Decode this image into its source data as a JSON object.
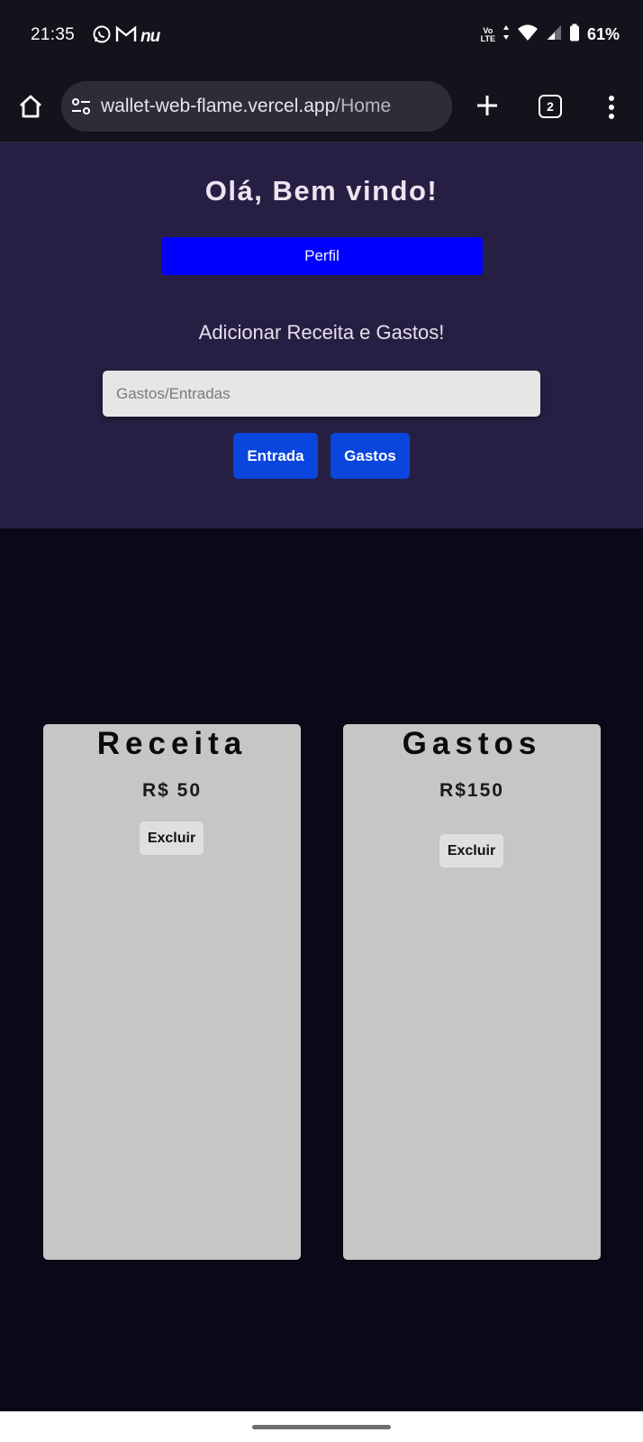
{
  "status_bar": {
    "time": "21:35",
    "notif_text": "nu",
    "battery": "61%",
    "volte_top": "Vo",
    "volte_bottom": "LTE"
  },
  "browser": {
    "url_host": "wallet-web-flame.vercel.app",
    "url_path": "/Home",
    "tab_count": "2"
  },
  "hero": {
    "title": "Olá, Bem vindo!",
    "profile_button": "Perfil",
    "add_heading": "Adicionar Receita e Gastos!",
    "input_placeholder": "Gastos/Entradas",
    "entrada_button": "Entrada",
    "gastos_button": "Gastos"
  },
  "cards": {
    "receita": {
      "title": "Receita",
      "amount": "R$ 50",
      "delete_label": "Excluir"
    },
    "gastos": {
      "title": "Gastos",
      "amount": "R$150",
      "delete_label": "Excluir"
    }
  },
  "colors": {
    "hero_bg": "#271f43",
    "page_bg": "#0b0917",
    "profile_button": "#0000ff",
    "action_button": "#0a45dd",
    "card_bg": "#c7c5c6"
  }
}
